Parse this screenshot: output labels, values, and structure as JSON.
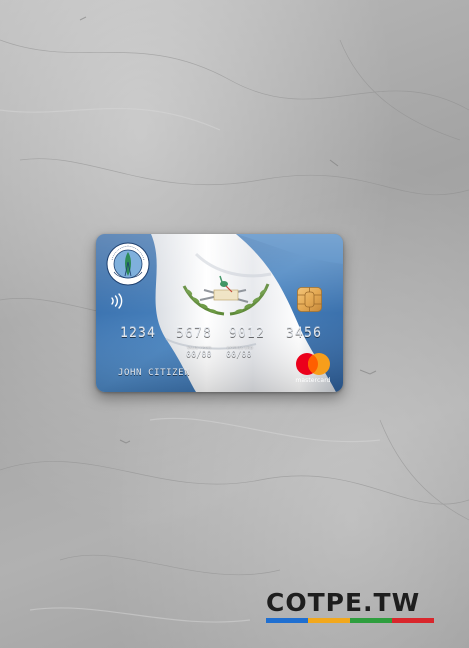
{
  "card": {
    "number_groups": [
      "1234",
      "5678",
      "9012",
      "3456"
    ],
    "valid_from_label": "VALID FROM",
    "expires_end_label": "EXPIRES END",
    "valid_from": "00/00",
    "expires_end": "00/00",
    "cardholder": "JOHN CITIZEN",
    "network": "mastercard",
    "issuer_seal_text": "BANCO DE GUATEMALA"
  },
  "watermark": {
    "text": "COTPE.TW",
    "bar_colors": [
      "#1f6fd1",
      "#f2a81d",
      "#2e9e3e",
      "#d9262c"
    ]
  },
  "colors": {
    "flag_blue": "#3f78b3",
    "flag_white": "#f3f4f6",
    "mastercard_red": "#eb001b",
    "mastercard_yellow": "#f79e1b",
    "chip_gold": "#e4aa55"
  }
}
